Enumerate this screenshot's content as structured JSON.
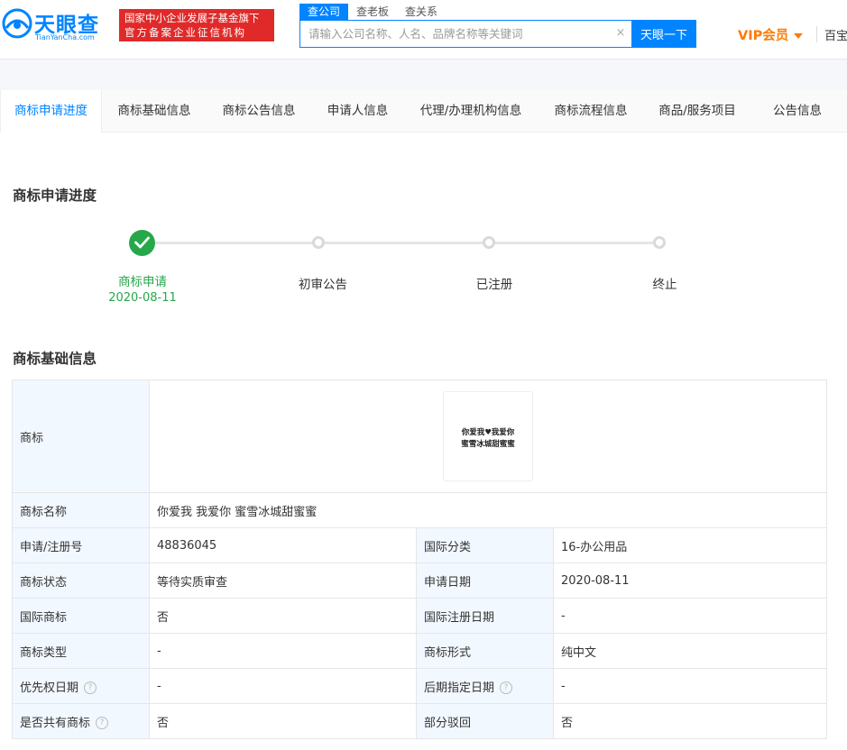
{
  "header": {
    "logo_text": "天眼查",
    "logo_sub": "TianYanCha.com",
    "badge_line1": "国家中小企业发展子基金旗下",
    "badge_line2": "官方备案企业征信机构",
    "search_tabs": [
      "查公司",
      "查老板",
      "查关系"
    ],
    "search_placeholder": "请输入公司名称、人名、品牌名称等关键词",
    "clear_glyph": "×",
    "search_button": "天眼一下",
    "vip_label": "VIP会员",
    "nav_item": "百宝箱"
  },
  "tabs": [
    "商标申请进度",
    "商标基础信息",
    "商标公告信息",
    "申请人信息",
    "代理/办理机构信息",
    "商标流程信息",
    "商品/服务项目",
    "公告信息"
  ],
  "progress": {
    "title": "商标申请进度",
    "steps": [
      {
        "label": "商标申请",
        "date": "2020-08-11",
        "done": true
      },
      {
        "label": "初审公告",
        "date": "",
        "done": false
      },
      {
        "label": "已注册",
        "date": "",
        "done": false
      },
      {
        "label": "终止",
        "date": "",
        "done": false
      }
    ],
    "done_color": "#26a84a"
  },
  "basic_info": {
    "title": "商标基础信息",
    "trademark_label": "商标",
    "trademark_image_line1": "你爱我♥我爱你",
    "trademark_image_line2": "蜜雪冰城甜蜜蜜",
    "name_label": "商标名称",
    "name_value": "你爱我 我爱你 蜜雪冰城甜蜜蜜",
    "rows": [
      {
        "l1": "申请/注册号",
        "v1": "48836045",
        "l2": "国际分类",
        "v2": "16-办公用品"
      },
      {
        "l1": "商标状态",
        "v1": "等待实质审查",
        "l2": "申请日期",
        "v2": "2020-08-11"
      },
      {
        "l1": "国际商标",
        "v1": "否",
        "l2": "国际注册日期",
        "v2": "-"
      },
      {
        "l1": "商标类型",
        "v1": "-",
        "l2": "商标形式",
        "v2": "纯中文"
      },
      {
        "l1": "优先权日期",
        "v1": "-",
        "l2": "后期指定日期",
        "v2": "-"
      },
      {
        "l1": "是否共有商标",
        "v1": "否",
        "l2": "部分驳回",
        "v2": "否"
      }
    ],
    "help_glyph": "?"
  },
  "colors": {
    "brand_blue": "#0084ff",
    "vip_orange": "#ff7a00",
    "badge_red": "#e02a2a",
    "label_bg": "#f2f8ff"
  }
}
